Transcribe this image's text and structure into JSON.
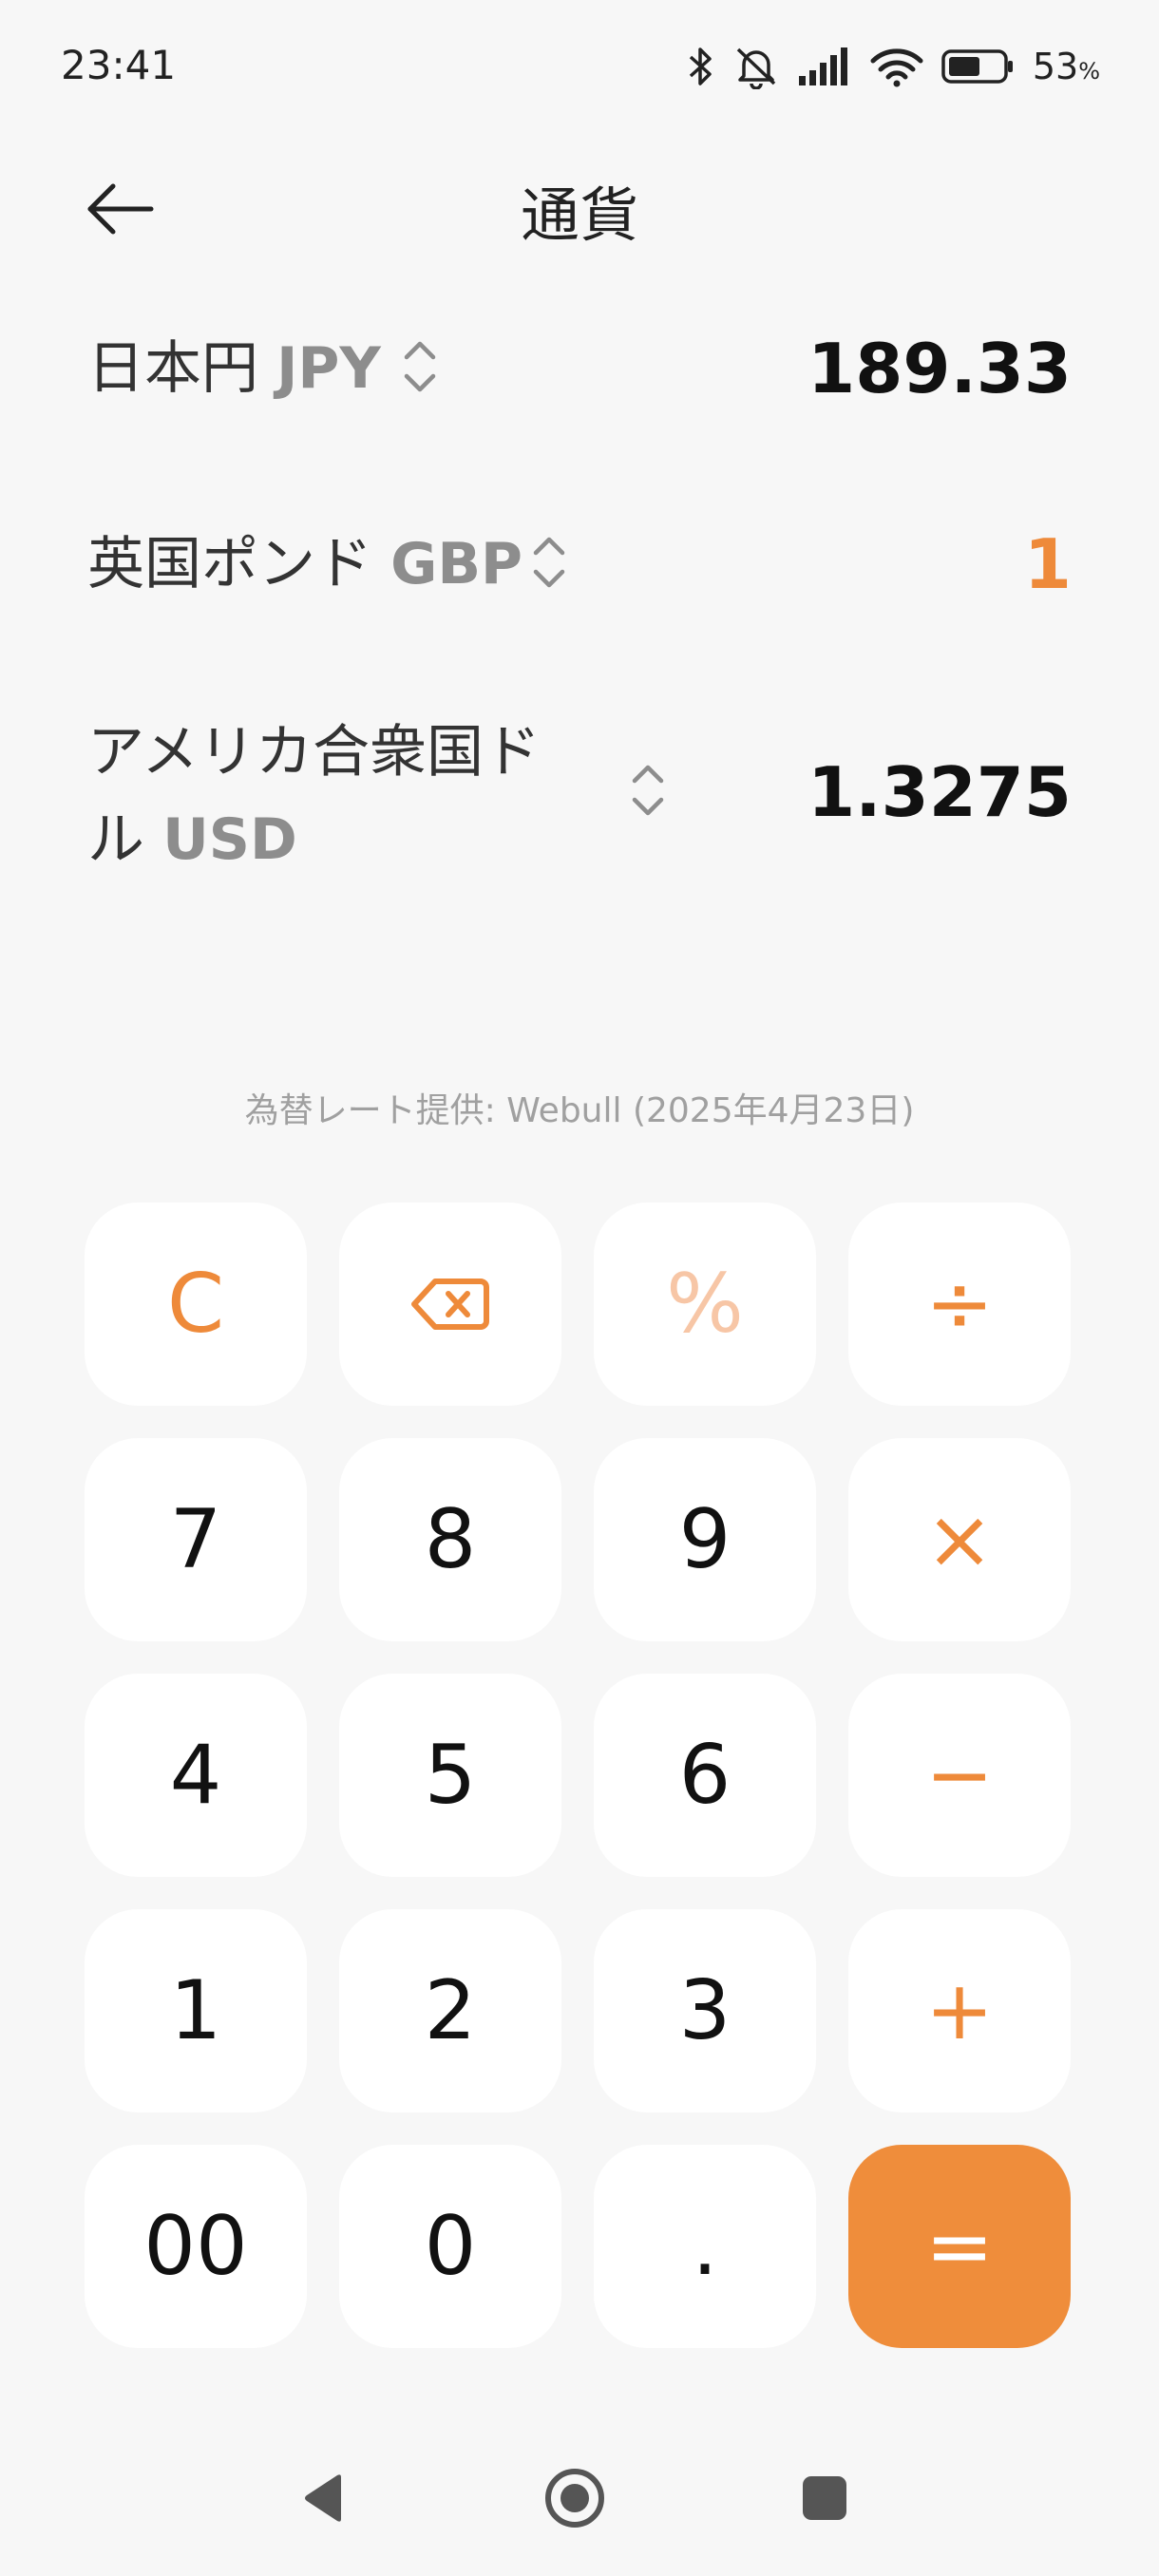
{
  "status_bar": {
    "time": "23:41",
    "battery_percent": "53",
    "battery_unit": "%",
    "icons": [
      "bluetooth-icon",
      "mute-icon",
      "signal-icon",
      "wifi-icon",
      "battery-icon"
    ]
  },
  "header": {
    "title": "通貨",
    "back_icon": "arrow-left-icon"
  },
  "currencies": [
    {
      "name": "日本円",
      "code": "JPY",
      "value": "189.33",
      "active": false
    },
    {
      "name": "英国ポンド",
      "code": "GBP",
      "value": "1",
      "active": true
    },
    {
      "name_line1": "アメリカ合衆国ド",
      "name_line2": "ル",
      "code": "USD",
      "value": "1.3275",
      "active": false
    }
  ],
  "rate_note": "為替レート提供: Webull (2025年4月23日)",
  "keypad": {
    "clear": "C",
    "backspace_icon": "backspace-icon",
    "percent": "%",
    "divide": "÷",
    "multiply": "×",
    "minus": "−",
    "plus": "+",
    "equals": "=",
    "digits": [
      "7",
      "8",
      "9",
      "4",
      "5",
      "6",
      "1",
      "2",
      "3",
      "00",
      "0",
      "."
    ]
  },
  "nav_bar": {
    "icons": [
      "back-triangle-icon",
      "home-circle-icon",
      "recents-square-icon"
    ]
  },
  "colors": {
    "accent": "#ee8a3a",
    "accent_faded": "#f7c6a6",
    "background": "#f7f7f7",
    "key_background": "#ffffff"
  }
}
